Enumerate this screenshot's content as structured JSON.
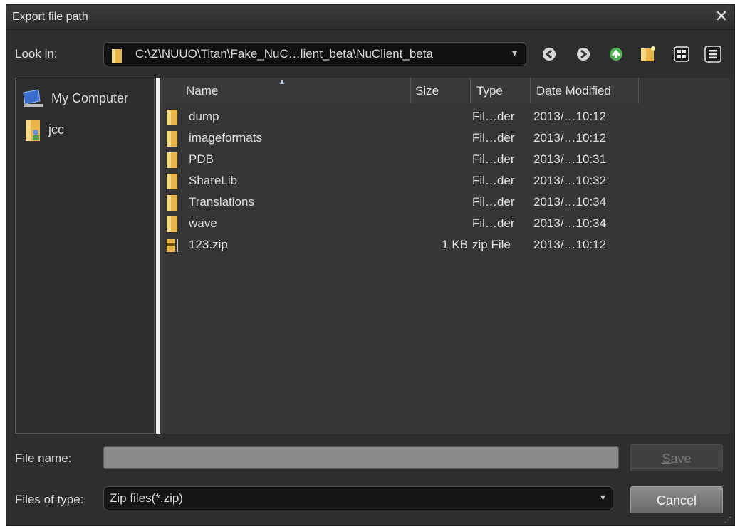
{
  "window": {
    "title": "Export file path",
    "close_glyph": "✕"
  },
  "look_in": {
    "label": "Look in:",
    "path": "C:\\Z\\NUUO\\Titan\\Fake_NuC…lient_beta\\NuClient_beta",
    "arrow": "▾"
  },
  "nav_icons": [
    "back-icon",
    "forward-icon",
    "up-folder-icon",
    "new-folder-icon",
    "list-view-icon",
    "detail-view-icon"
  ],
  "sidebar": {
    "items": [
      {
        "label": "My Computer",
        "icon": "computer-icon"
      },
      {
        "label": "jcc",
        "icon": "user-folder-icon"
      }
    ]
  },
  "columns": {
    "name": "Name",
    "size": "Size",
    "type": "Type",
    "date": "Date Modified"
  },
  "sort_indicator": "▴",
  "files": [
    {
      "name": "dump",
      "size": "",
      "type": "Fil…der",
      "date": "2013/…10:12",
      "icon": "folder-icon"
    },
    {
      "name": "imageformats",
      "size": "",
      "type": "Fil…der",
      "date": "2013/…10:12",
      "icon": "folder-icon"
    },
    {
      "name": "PDB",
      "size": "",
      "type": "Fil…der",
      "date": "2013/…10:31",
      "icon": "folder-icon"
    },
    {
      "name": "ShareLib",
      "size": "",
      "type": "Fil…der",
      "date": "2013/…10:32",
      "icon": "folder-icon"
    },
    {
      "name": "Translations",
      "size": "",
      "type": "Fil…der",
      "date": "2013/…10:34",
      "icon": "folder-icon"
    },
    {
      "name": "wave",
      "size": "",
      "type": "Fil…der",
      "date": "2013/…10:34",
      "icon": "folder-icon"
    },
    {
      "name": "123.zip",
      "size": "1 KB",
      "type": "zip File",
      "date": "2013/…10:12",
      "icon": "zip-file-icon"
    }
  ],
  "file_name": {
    "label_pre": "File ",
    "label_u": "n",
    "label_post": "ame:",
    "value": ""
  },
  "file_type": {
    "label": "Files of type:",
    "value": "Zip files(*.zip)",
    "arrow": "▾"
  },
  "buttons": {
    "save_u": "S",
    "save_rest": "ave",
    "cancel": "Cancel"
  },
  "colors": {
    "accent_folder": "#e8b64a",
    "up_arrow": "#4caf50"
  }
}
